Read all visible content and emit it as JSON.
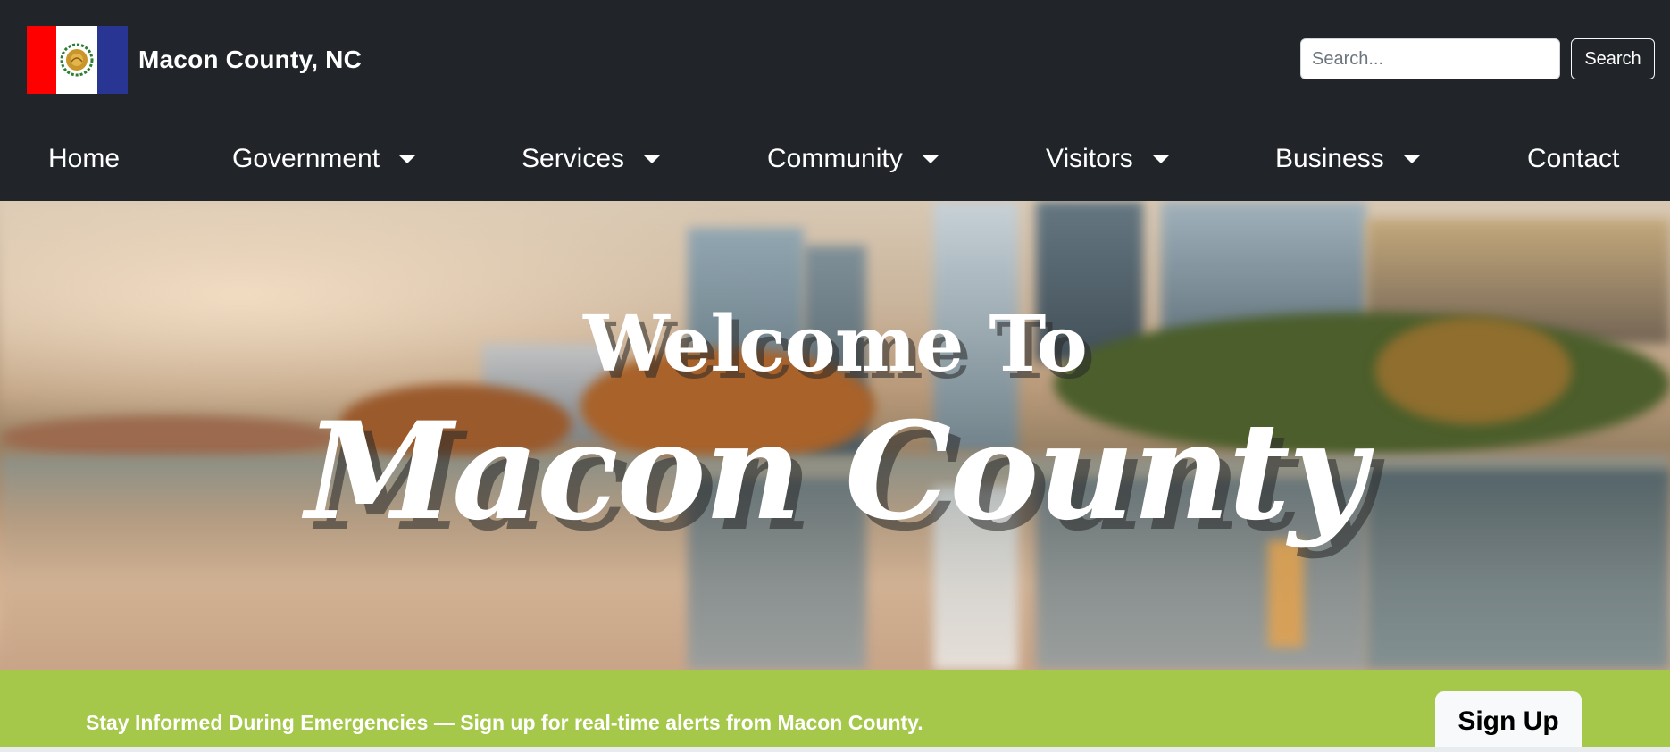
{
  "header": {
    "site_title": "Macon County, NC",
    "logo": "county-flag-seal",
    "search": {
      "placeholder": "Search...",
      "value": "",
      "button_label": "Search"
    }
  },
  "nav": {
    "items": [
      {
        "label": "Home",
        "dropdown": false
      },
      {
        "label": "Government",
        "dropdown": true
      },
      {
        "label": "Services",
        "dropdown": true
      },
      {
        "label": "Community",
        "dropdown": true
      },
      {
        "label": "Visitors",
        "dropdown": true
      },
      {
        "label": "Business",
        "dropdown": true
      },
      {
        "label": "Contact",
        "dropdown": false
      }
    ]
  },
  "hero": {
    "welcome": "Welcome To",
    "title": "Macon County"
  },
  "alert": {
    "text": "Stay Informed During Emergencies — Sign up for real-time alerts from Macon County.",
    "button_label": "Sign Up"
  },
  "colors": {
    "header_bg": "#212529",
    "alert_bg": "#a5c84a",
    "flag_red": "#ff0000",
    "flag_blue": "#283593"
  }
}
